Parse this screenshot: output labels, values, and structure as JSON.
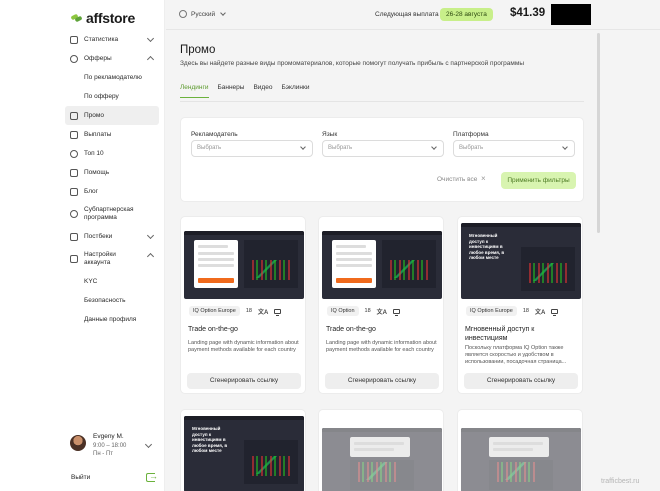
{
  "brand": {
    "name": "affstore"
  },
  "nav": {
    "items": [
      {
        "label": "Статистика",
        "icon": "stats-icon"
      },
      {
        "label": "Офферы",
        "icon": "tag-icon"
      },
      {
        "label": "По рекламодателю"
      },
      {
        "label": "По офферу"
      },
      {
        "label": "Промо",
        "icon": "image-icon"
      },
      {
        "label": "Выплаты",
        "icon": "wallet-icon"
      },
      {
        "label": "Топ 10",
        "icon": "trophy-icon"
      },
      {
        "label": "Помощь",
        "icon": "help-icon"
      },
      {
        "label": "Блог",
        "icon": "blog-icon"
      },
      {
        "label": "Субпартнерская программа",
        "icon": "users-icon"
      },
      {
        "label": "Постбеки",
        "icon": "postback-icon"
      },
      {
        "label": "Настройки аккаунта",
        "icon": "settings-icon"
      },
      {
        "label": "KYC"
      },
      {
        "label": "Безопасность"
      },
      {
        "label": "Данные профиля"
      }
    ],
    "logout": "Выйти"
  },
  "user": {
    "name": "Evgeny M.",
    "hours": "9:00 – 18:00",
    "days": "Пн - Пт"
  },
  "header": {
    "language": "Русский",
    "next_payment_label": "Следующая выплата",
    "next_payment_dates": "26-28 августа",
    "balance": "$41.39"
  },
  "page": {
    "title": "Промо",
    "description": "Здесь вы найдете разные виды промоматериалов, которые помогут получать прибыль с партнерской программы",
    "tabs": [
      "Лендинги",
      "Баннеры",
      "Видео",
      "Бэклинки"
    ],
    "active_tab": "Лендинги"
  },
  "filters": {
    "advertiser_label": "Рекламодатель",
    "language_label": "Язык",
    "platform_label": "Платформа",
    "select_placeholder": "Выбрать",
    "clear_all": "Очистить все",
    "apply": "Применить фильтры"
  },
  "cards": [
    {
      "advertiser": "IQ Option Europe",
      "age": "18",
      "title": "Trade on-the-go",
      "description": "Landing page with dynamic information about payment methods available for each country",
      "button": "Сгенерировать ссылку"
    },
    {
      "advertiser": "IQ Option",
      "age": "18",
      "title": "Trade on-the-go",
      "description": "Landing page with dynamic information about payment methods available for each country",
      "button": "Сгенерировать ссылку"
    },
    {
      "advertiser": "IQ Option Europe",
      "age": "18",
      "title": "Мгновенный доступ к инвестициям",
      "description": "Поскольку платформа IQ Option также является скоростью и удобством в использовании, посадочная страница...",
      "button": "Сгенерировать ссылку",
      "thumb_title": "Мгновенный доступ к инвестициям в любое время, в любом месте"
    }
  ],
  "cards_row2": [
    {
      "thumb_title": "Мгновенный доступ к инвестициям в любое время, в любом месте"
    },
    {
      "thumb_title": ""
    },
    {
      "thumb_title": ""
    }
  ],
  "watermark": "trafficbest.ru",
  "colors": {
    "accent": "#6bb23c",
    "badge": "#c8ef8a",
    "apply_bg": "#d8f4b0"
  }
}
